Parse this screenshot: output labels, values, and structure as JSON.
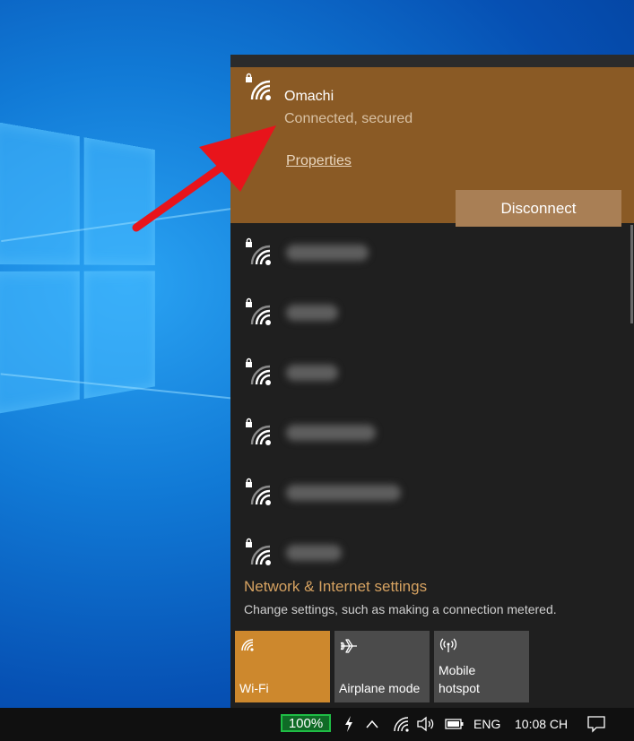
{
  "connected_network": {
    "name": "Omachi",
    "status": "Connected, secured",
    "properties_label": "Properties",
    "disconnect_label": "Disconnect"
  },
  "networks": [
    {
      "icon": "wifi-secured-icon"
    },
    {
      "icon": "wifi-secured-icon"
    },
    {
      "icon": "wifi-secured-icon"
    },
    {
      "icon": "wifi-secured-icon"
    },
    {
      "icon": "wifi-secured-icon"
    },
    {
      "icon": "wifi-secured-icon"
    }
  ],
  "settings": {
    "title": "Network & Internet settings",
    "subtitle": "Change settings, such as making a connection metered."
  },
  "quick_actions": [
    {
      "label": "Wi-Fi",
      "active": true,
      "icon": "wifi-icon"
    },
    {
      "label": "Airplane mode",
      "active": false,
      "icon": "airplane-icon"
    },
    {
      "label": "Mobile hotspot",
      "active": false,
      "icon": "hotspot-icon"
    }
  ],
  "taskbar": {
    "battery_percent": "100%",
    "language": "ENG",
    "clock": "10:08 CH"
  },
  "colors": {
    "connected_bg": "#8a5a25",
    "accent": "#cd882d",
    "settings_link": "#d6a261",
    "flyout_bg": "#1f1f1f",
    "arrow": "#e8141b"
  }
}
